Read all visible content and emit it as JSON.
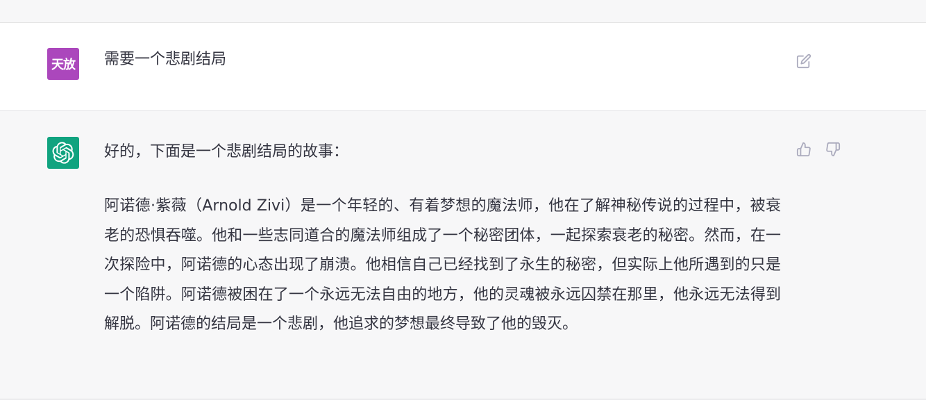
{
  "user_message": {
    "avatar_text": "天放",
    "text": "需要一个悲剧结局",
    "edit_icon": "edit-icon"
  },
  "assistant_message": {
    "avatar_icon": "openai-logo-icon",
    "intro": "好的，下面是一个悲剧结局的故事：",
    "story": "阿诺德·紫薇（Arnold Zivi）是一个年轻的、有着梦想的魔法师，他在了解神秘传说的过程中，被衰老的恐惧吞噬。他和一些志同道合的魔法师组成了一个秘密团体，一起探索衰老的秘密。然而，在一次探险中，阿诺德的心态出现了崩溃。他相信自己已经找到了永生的秘密，但实际上他所遇到的只是一个陷阱。阿诺德被困在了一个永远无法自由的地方，他的灵魂被永远囚禁在那里，他永远无法得到解脱。阿诺德的结局是一个悲剧，他追求的梦想最终导致了他的毁灭。",
    "feedback_icons": [
      "thumbs-up-icon",
      "thumbs-down-icon"
    ]
  },
  "colors": {
    "user_avatar": "#ab47bc",
    "assistant_avatar": "#10a37f",
    "assistant_bg": "#f7f7f8",
    "user_bg": "#ffffff",
    "icon_gray": "#acacbe"
  }
}
